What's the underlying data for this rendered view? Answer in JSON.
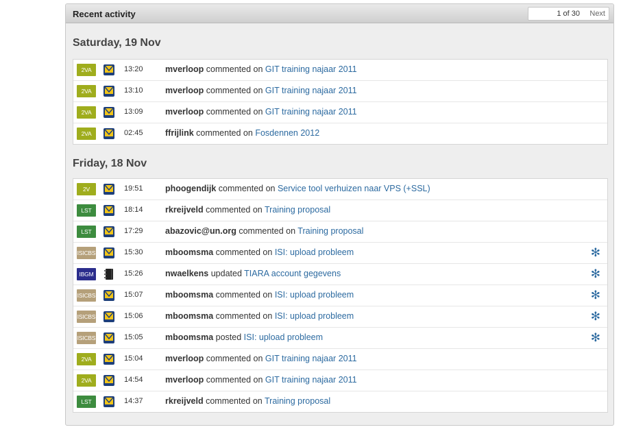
{
  "header": {
    "title": "Recent activity",
    "pager": {
      "count": "1 of 30",
      "next_label": "Next"
    }
  },
  "groups": [
    {
      "heading": "Saturday, 19 Nov",
      "items": [
        {
          "badge": "2VA",
          "badge_color": "#9fad1d",
          "icon": "document-icon",
          "time": "13:20",
          "user": "mverloop",
          "action": "commented on",
          "target": "GIT training najaar 2011",
          "starred": false
        },
        {
          "badge": "2VA",
          "badge_color": "#9fad1d",
          "icon": "document-icon",
          "time": "13:10",
          "user": "mverloop",
          "action": "commented on",
          "target": "GIT training najaar 2011",
          "starred": false
        },
        {
          "badge": "2VA",
          "badge_color": "#9fad1d",
          "icon": "document-icon",
          "time": "13:09",
          "user": "mverloop",
          "action": "commented on",
          "target": "GIT training najaar 2011",
          "starred": false
        },
        {
          "badge": "2VA",
          "badge_color": "#9fad1d",
          "icon": "document-icon",
          "time": "02:45",
          "user": "ffrijlink",
          "action": "commented on",
          "target": "Fosdennen 2012",
          "starred": false
        }
      ]
    },
    {
      "heading": "Friday, 18 Nov",
      "items": [
        {
          "badge": "2V",
          "badge_color": "#9fad1d",
          "icon": "document-icon",
          "time": "19:51",
          "user": "phoogendijk",
          "action": "commented on",
          "target": "Service tool verhuizen naar VPS (+SSL)",
          "starred": false
        },
        {
          "badge": "LST",
          "badge_color": "#3d8c3f",
          "icon": "document-icon",
          "time": "18:14",
          "user": "rkreijveld",
          "action": "commented on",
          "target": "Training proposal",
          "starred": false
        },
        {
          "badge": "LST",
          "badge_color": "#3d8c3f",
          "icon": "document-icon",
          "time": "17:29",
          "user": "abazovic@un.org",
          "action": "commented on",
          "target": "Training proposal",
          "starred": false
        },
        {
          "badge": "ISICBS",
          "badge_color": "#b5a07a",
          "icon": "document-icon",
          "time": "15:30",
          "user": "mboomsma",
          "action": "commented on",
          "target": "ISI: upload probleem",
          "starred": true
        },
        {
          "badge": "IBGM",
          "badge_color": "#2b2d8c",
          "icon": "notebook-icon",
          "time": "15:26",
          "user": "nwaelkens",
          "action": "updated",
          "target": "TIARA account gegevens",
          "starred": true
        },
        {
          "badge": "ISICBS",
          "badge_color": "#b5a07a",
          "icon": "document-icon",
          "time": "15:07",
          "user": "mboomsma",
          "action": "commented on",
          "target": "ISI: upload probleem",
          "starred": true
        },
        {
          "badge": "ISICBS",
          "badge_color": "#b5a07a",
          "icon": "document-icon",
          "time": "15:06",
          "user": "mboomsma",
          "action": "commented on",
          "target": "ISI: upload probleem",
          "starred": true
        },
        {
          "badge": "ISICBS",
          "badge_color": "#b5a07a",
          "icon": "document-icon",
          "time": "15:05",
          "user": "mboomsma",
          "action": "posted",
          "target": "ISI: upload probleem",
          "starred": true
        },
        {
          "badge": "2VA",
          "badge_color": "#9fad1d",
          "icon": "document-icon",
          "time": "15:04",
          "user": "mverloop",
          "action": "commented on",
          "target": "GIT training najaar 2011",
          "starred": false
        },
        {
          "badge": "2VA",
          "badge_color": "#9fad1d",
          "icon": "document-icon",
          "time": "14:54",
          "user": "mverloop",
          "action": "commented on",
          "target": "GIT training najaar 2011",
          "starred": false
        },
        {
          "badge": "LST",
          "badge_color": "#3d8c3f",
          "icon": "document-icon",
          "time": "14:37",
          "user": "rkreijveld",
          "action": "commented on",
          "target": "Training proposal",
          "starred": false
        }
      ]
    }
  ]
}
